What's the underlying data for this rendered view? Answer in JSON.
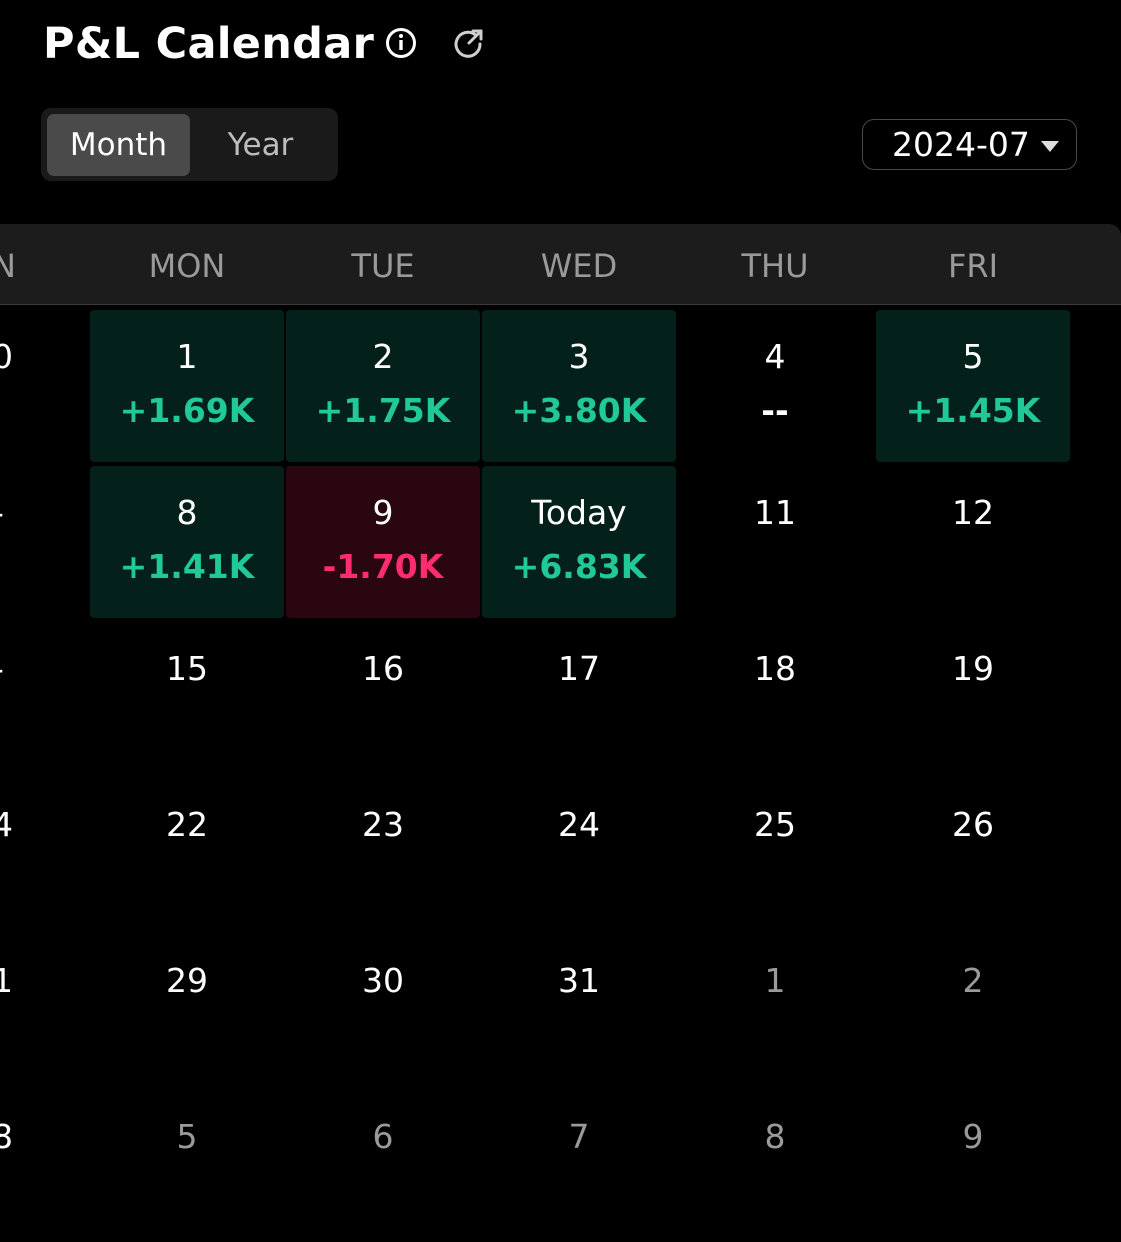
{
  "title": "P&L Calendar",
  "icons": {
    "info": "info-circle-icon",
    "share": "share-out-icon"
  },
  "view_toggle": {
    "month": "Month",
    "year": "Year",
    "selected": "Month"
  },
  "date_select": {
    "value": "2024-07"
  },
  "colors": {
    "positive": "#20c997",
    "negative": "#ff2d6f",
    "positive_bg": "#04201b",
    "negative_bg": "#2a0610"
  },
  "weekdays": [
    "N",
    "MON",
    "TUE",
    "WED",
    "THU",
    "FRI"
  ],
  "left_edge": [
    "0",
    "-",
    "-",
    "4",
    "1",
    "8"
  ],
  "weeks": [
    [
      {
        "day": "1",
        "pnl": "+1.69K",
        "type": "pos"
      },
      {
        "day": "2",
        "pnl": "+1.75K",
        "type": "pos"
      },
      {
        "day": "3",
        "pnl": "+3.80K",
        "type": "pos"
      },
      {
        "day": "4",
        "pnl": "--",
        "type": "none"
      },
      {
        "day": "5",
        "pnl": "+1.45K",
        "type": "pos"
      }
    ],
    [
      {
        "day": "8",
        "pnl": "+1.41K",
        "type": "pos"
      },
      {
        "day": "9",
        "pnl": "-1.70K",
        "type": "neg"
      },
      {
        "day": "Today",
        "pnl": "+6.83K",
        "type": "pos"
      },
      {
        "day": "11",
        "pnl": "",
        "type": ""
      },
      {
        "day": "12",
        "pnl": "",
        "type": ""
      }
    ],
    [
      {
        "day": "15",
        "pnl": "",
        "type": ""
      },
      {
        "day": "16",
        "pnl": "",
        "type": ""
      },
      {
        "day": "17",
        "pnl": "",
        "type": ""
      },
      {
        "day": "18",
        "pnl": "",
        "type": ""
      },
      {
        "day": "19",
        "pnl": "",
        "type": ""
      }
    ],
    [
      {
        "day": "22",
        "pnl": "",
        "type": ""
      },
      {
        "day": "23",
        "pnl": "",
        "type": ""
      },
      {
        "day": "24",
        "pnl": "",
        "type": ""
      },
      {
        "day": "25",
        "pnl": "",
        "type": ""
      },
      {
        "day": "26",
        "pnl": "",
        "type": ""
      }
    ],
    [
      {
        "day": "29",
        "pnl": "",
        "type": ""
      },
      {
        "day": "30",
        "pnl": "",
        "type": ""
      },
      {
        "day": "31",
        "pnl": "",
        "type": ""
      },
      {
        "day": "1",
        "pnl": "",
        "type": "",
        "dim": true
      },
      {
        "day": "2",
        "pnl": "",
        "type": "",
        "dim": true
      }
    ],
    [
      {
        "day": "5",
        "pnl": "",
        "type": "",
        "dim": true
      },
      {
        "day": "6",
        "pnl": "",
        "type": "",
        "dim": true
      },
      {
        "day": "7",
        "pnl": "",
        "type": "",
        "dim": true
      },
      {
        "day": "8",
        "pnl": "",
        "type": "",
        "dim": true
      },
      {
        "day": "9",
        "pnl": "",
        "type": "",
        "dim": true
      }
    ]
  ]
}
